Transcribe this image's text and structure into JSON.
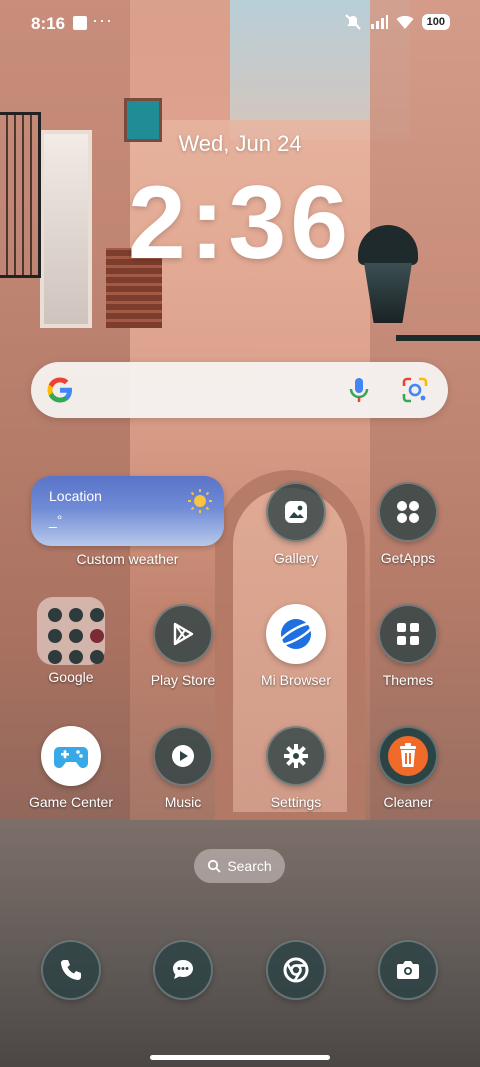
{
  "status_bar": {
    "time": "8:16",
    "dots": "···",
    "battery": "100",
    "icons": [
      "notification-square-icon",
      "mute-icon",
      "signal-icon",
      "wifi-icon",
      "battery-icon"
    ]
  },
  "lockscreen": {
    "date": "Wed, Jun 24",
    "clock": "2:36"
  },
  "search_bar": {
    "icons": [
      "google-logo-icon",
      "microphone-icon",
      "google-lens-icon"
    ]
  },
  "weather_widget": {
    "location": "Location",
    "temperature": "_°",
    "label": "Custom weather",
    "icon": "sun-icon"
  },
  "apps": {
    "gallery": "Gallery",
    "getapps": "GetApps",
    "google": "Google",
    "play_store": "Play Store",
    "mi_browser": "Mi Browser",
    "themes": "Themes",
    "game_center": "Game Center",
    "music": "Music",
    "settings": "Settings",
    "cleaner": "Cleaner"
  },
  "home_search": {
    "label": "Search"
  },
  "dock": [
    "phone-icon",
    "messages-icon",
    "chrome-icon",
    "camera-icon"
  ],
  "colors": {
    "icon_bg": "#2c4446",
    "cleaner_accent": "#f06a2a",
    "gamecenter_accent": "#38a8e6",
    "browser_accent": "#1e6fe0"
  }
}
